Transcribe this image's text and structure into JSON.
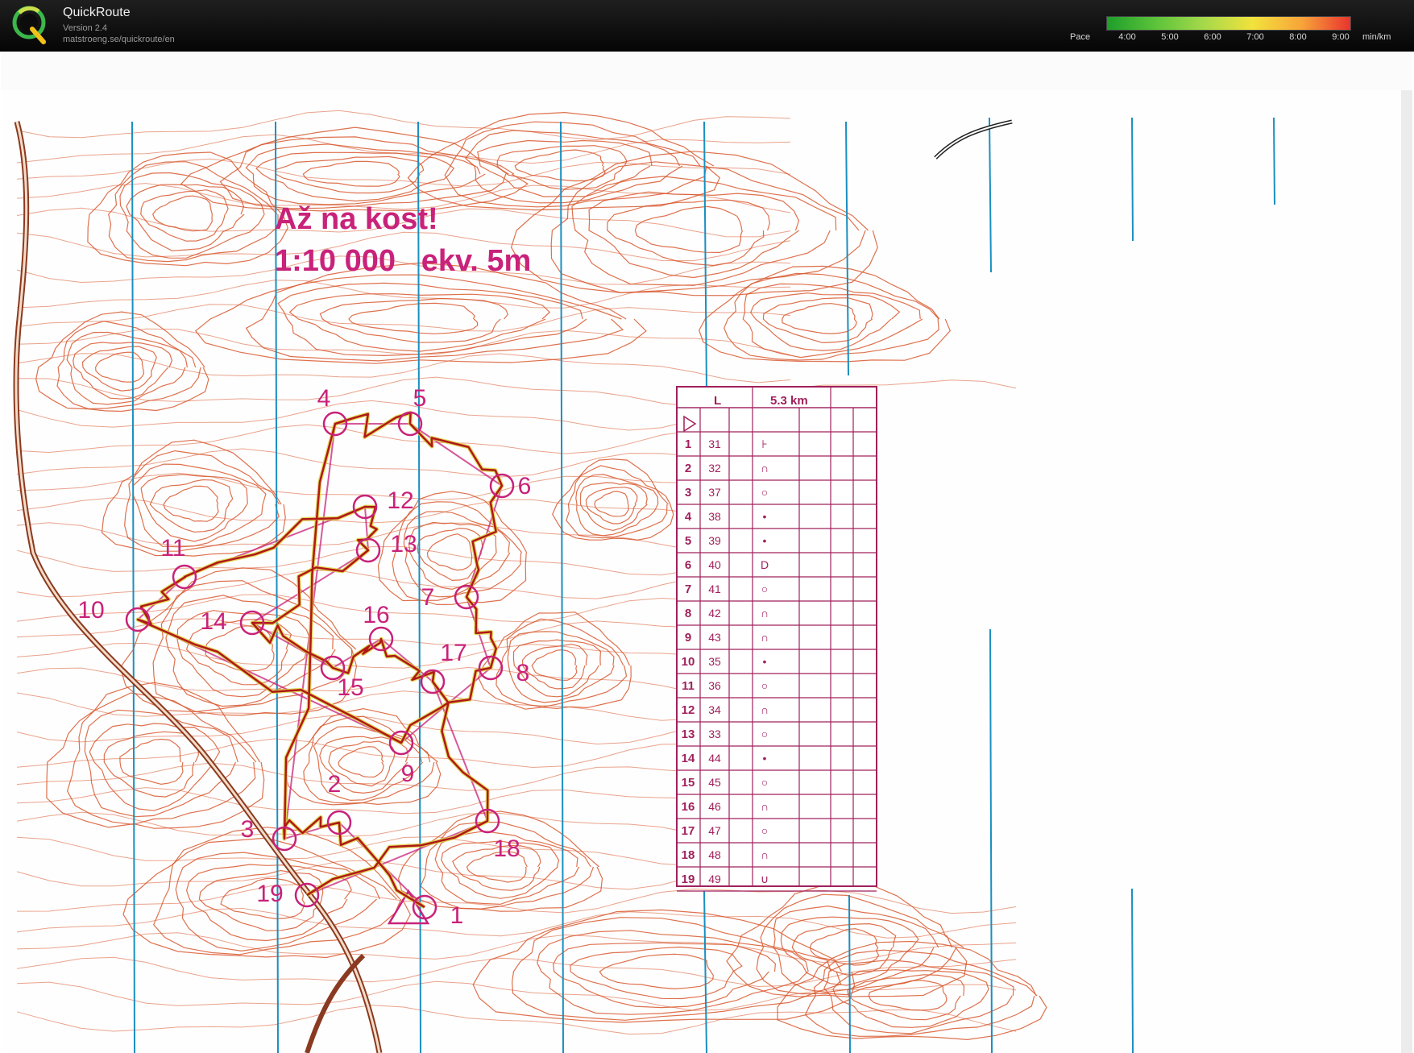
{
  "app": {
    "title": "QuickRoute",
    "version": "Version 2.4",
    "url": "matstroeng.se/quickroute/en"
  },
  "pace_scale": {
    "label": "Pace",
    "ticks": [
      "4:00",
      "5:00",
      "6:00",
      "7:00",
      "8:00",
      "9:00"
    ],
    "unit": "min/km",
    "colors": [
      "#1e9e2a",
      "#5cc33a",
      "#a6d94a",
      "#f2e23c",
      "#f8a43a",
      "#e8342e"
    ]
  },
  "map": {
    "title": "Až na kost!",
    "scale_line": "1:10 000   ekv. 5m",
    "course_color": "#c8227a",
    "route_color": "#b01818",
    "contour_color": "#d8582e",
    "grid_color": "#1a8fc0",
    "controls": [
      "1",
      "2",
      "3",
      "4",
      "5",
      "6",
      "7",
      "8",
      "9",
      "10",
      "11",
      "12",
      "13",
      "14",
      "15",
      "16",
      "17",
      "18",
      "19"
    ]
  },
  "description_sheet": {
    "class": "L",
    "length": "5.3 km",
    "rows": [
      {
        "n": "1",
        "code": "31",
        "symbol": "⊦"
      },
      {
        "n": "2",
        "code": "32",
        "symbol": "∩"
      },
      {
        "n": "3",
        "code": "37",
        "symbol": "○"
      },
      {
        "n": "4",
        "code": "38",
        "symbol": "•"
      },
      {
        "n": "5",
        "code": "39",
        "symbol": "•"
      },
      {
        "n": "6",
        "code": "40",
        "symbol": "D"
      },
      {
        "n": "7",
        "code": "41",
        "symbol": "○"
      },
      {
        "n": "8",
        "code": "42",
        "symbol": "∩"
      },
      {
        "n": "9",
        "code": "43",
        "symbol": "∩"
      },
      {
        "n": "10",
        "code": "35",
        "symbol": "•"
      },
      {
        "n": "11",
        "code": "36",
        "symbol": "○"
      },
      {
        "n": "12",
        "code": "34",
        "symbol": "∩"
      },
      {
        "n": "13",
        "code": "33",
        "symbol": "○"
      },
      {
        "n": "14",
        "code": "44",
        "symbol": "•"
      },
      {
        "n": "15",
        "code": "45",
        "symbol": "○"
      },
      {
        "n": "16",
        "code": "46",
        "symbol": "∩"
      },
      {
        "n": "17",
        "code": "47",
        "symbol": "○"
      },
      {
        "n": "18",
        "code": "48",
        "symbol": "∩"
      },
      {
        "n": "19",
        "code": "49",
        "symbol": "∪"
      }
    ]
  }
}
